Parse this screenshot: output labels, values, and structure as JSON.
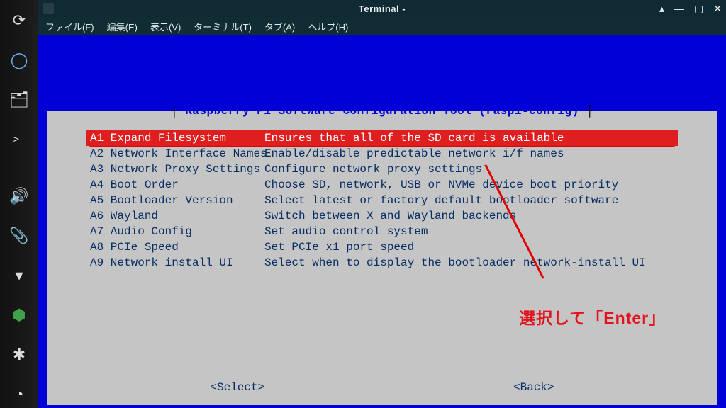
{
  "launcher": {
    "items": [
      {
        "name": "refresh-icon",
        "glyph": "⟳"
      },
      {
        "name": "browser-icon",
        "glyph": "◯"
      },
      {
        "name": "files-icon",
        "glyph": "🗂"
      },
      {
        "name": "terminal-icon",
        "glyph": ">_"
      }
    ],
    "lower": [
      {
        "name": "volume-icon",
        "glyph": "🔊"
      },
      {
        "name": "attachment-icon",
        "glyph": "📎"
      },
      {
        "name": "wifi-icon",
        "glyph": "▾"
      },
      {
        "name": "cube-icon",
        "glyph": "⬢"
      },
      {
        "name": "bluetooth-icon",
        "glyph": "✱"
      },
      {
        "name": "clock-icon",
        "glyph": "◔"
      }
    ]
  },
  "window": {
    "title": "Terminal -",
    "controls": {
      "pin": "▴",
      "min": "—",
      "max": "▢",
      "close": "✕"
    },
    "menu": [
      "ファイル(F)",
      "編集(E)",
      "表示(V)",
      "ターミナル(T)",
      "タブ(A)",
      "ヘルプ(H)"
    ]
  },
  "tui": {
    "title_prefix": "┤ ",
    "title": "Raspberry Pi Software Configuration Tool (raspi-config)",
    "title_suffix": " ├",
    "items": [
      {
        "label": "A1 Expand Filesystem",
        "desc": "Ensures that all of the SD card is available",
        "selected": true
      },
      {
        "label": "A2 Network Interface Names",
        "desc": "Enable/disable predictable network i/f names",
        "selected": false
      },
      {
        "label": "A3 Network Proxy Settings",
        "desc": "Configure network proxy settings",
        "selected": false
      },
      {
        "label": "A4 Boot Order",
        "desc": "Choose SD, network, USB or NVMe device boot priority",
        "selected": false
      },
      {
        "label": "A5 Bootloader Version",
        "desc": "Select latest or factory default bootloader software",
        "selected": false
      },
      {
        "label": "A6 Wayland",
        "desc": "Switch between X and Wayland backends",
        "selected": false
      },
      {
        "label": "A7 Audio Config",
        "desc": "Set audio control system",
        "selected": false
      },
      {
        "label": "A8 PCIe Speed",
        "desc": "Set PCIe x1 port speed",
        "selected": false
      },
      {
        "label": "A9 Network install UI",
        "desc": "Select when to display the bootloader network-install UI",
        "selected": false
      }
    ],
    "buttons": {
      "select": "<Select>",
      "back": "<Back>"
    }
  },
  "annotation": {
    "text": "選択して「Enter」"
  }
}
